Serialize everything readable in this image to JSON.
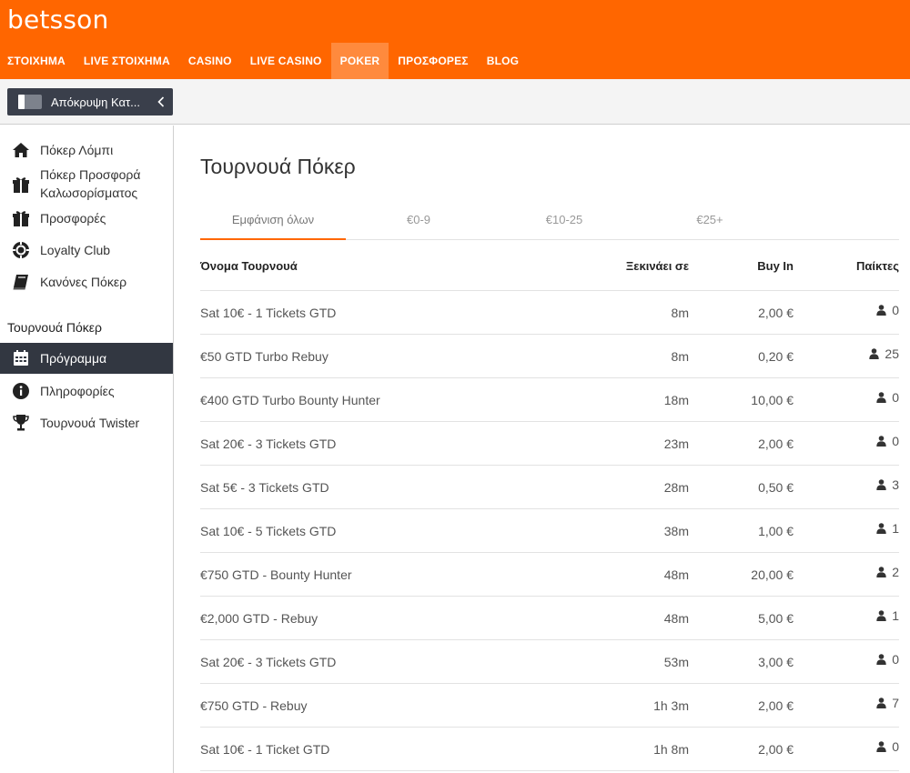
{
  "brand": {
    "logo_text": "betsson",
    "accent": "#ff6600"
  },
  "nav": [
    {
      "label": "ΣΤΟΙΧΗΜΑ",
      "active": false
    },
    {
      "label": "LIVE ΣΤΟΙΧΗΜΑ",
      "active": false
    },
    {
      "label": "CASINO",
      "active": false
    },
    {
      "label": "LIVE CASINO",
      "active": false
    },
    {
      "label": "POKER",
      "active": true
    },
    {
      "label": "ΠΡΟΣΦΟΡΕΣ",
      "active": false
    },
    {
      "label": "BLOG",
      "active": false
    }
  ],
  "subbar": {
    "hide_label": "Απόκρυψη Κατ..."
  },
  "sidebar": {
    "items": [
      {
        "label": "Πόκερ Λόμπι",
        "icon": "home-icon"
      },
      {
        "label": "Πόκερ Προσφορά",
        "label2": "Καλωσορίσματος",
        "icon": "gift-icon"
      },
      {
        "label": "Προσφορές",
        "icon": "gift-icon"
      },
      {
        "label": "Loyalty Club",
        "icon": "poker-chip-icon"
      },
      {
        "label": "Κανόνες Πόκερ",
        "icon": "book-icon"
      }
    ],
    "section_title": "Τουρνουά Πόκερ",
    "section_items": [
      {
        "label": "Πρόγραμμα",
        "icon": "calendar-icon",
        "active": true
      },
      {
        "label": "Πληροφορίες",
        "icon": "info-icon"
      },
      {
        "label": "Τουρνουά Twister",
        "icon": "trophy-icon"
      }
    ]
  },
  "main": {
    "title": "Τουρνουά Πόκερ",
    "tabs": [
      {
        "label": "Εμφάνιση όλων",
        "active": true
      },
      {
        "label": "€0-9"
      },
      {
        "label": "€10-25"
      },
      {
        "label": "€25+"
      }
    ],
    "columns": {
      "name": "Όνομα Τουρνουά",
      "start": "Ξεκινάει σε",
      "buyin": "Buy In",
      "players": "Παίκτες"
    },
    "rows": [
      {
        "name": "Sat 10€ - 1 Tickets GTD",
        "start": "8m",
        "buyin": "2,00 €",
        "players": "0"
      },
      {
        "name": "€50 GTD Turbo Rebuy",
        "start": "8m",
        "buyin": "0,20 €",
        "players": "25"
      },
      {
        "name": "€400 GTD Turbo Bounty Hunter",
        "start": "18m",
        "buyin": "10,00 €",
        "players": "0"
      },
      {
        "name": "Sat 20€ - 3 Tickets GTD",
        "start": "23m",
        "buyin": "2,00 €",
        "players": "0"
      },
      {
        "name": "Sat 5€ - 3 Tickets GTD",
        "start": "28m",
        "buyin": "0,50 €",
        "players": "3"
      },
      {
        "name": "Sat 10€ - 5 Tickets GTD",
        "start": "38m",
        "buyin": "1,00 €",
        "players": "1"
      },
      {
        "name": "€750 GTD - Bounty Hunter",
        "start": "48m",
        "buyin": "20,00 €",
        "players": "2"
      },
      {
        "name": "€2,000 GTD - Rebuy",
        "start": "48m",
        "buyin": "5,00 €",
        "players": "1"
      },
      {
        "name": "Sat 20€ - 3 Tickets GTD",
        "start": "53m",
        "buyin": "3,00 €",
        "players": "0"
      },
      {
        "name": "€750 GTD - Rebuy",
        "start": "1h 3m",
        "buyin": "2,00 €",
        "players": "7"
      },
      {
        "name": "Sat 10€ - 1 Ticket GTD",
        "start": "1h 8m",
        "buyin": "2,00 €",
        "players": "0"
      }
    ]
  }
}
